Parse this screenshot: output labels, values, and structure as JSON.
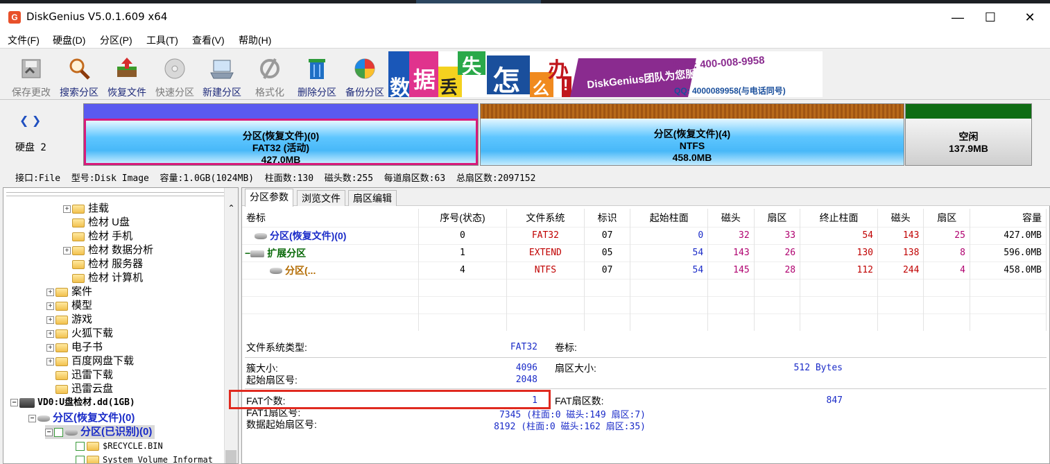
{
  "window": {
    "title": "DiskGenius V5.0.1.609 x64",
    "minimize": "—",
    "maximize": "☐",
    "close": "✕"
  },
  "menu": [
    "文件(F)",
    "硬盘(D)",
    "分区(P)",
    "工具(T)",
    "查看(V)",
    "帮助(H)"
  ],
  "toolbar": [
    {
      "label": "保存更改",
      "icon": "save-icon",
      "disabled": true
    },
    {
      "label": "搜索分区",
      "icon": "search-icon",
      "disabled": false
    },
    {
      "label": "恢复文件",
      "icon": "recover-icon",
      "disabled": false
    },
    {
      "label": "快速分区",
      "icon": "disc-icon",
      "disabled": true
    },
    {
      "label": "新建分区",
      "icon": "new-partition-icon",
      "disabled": false
    },
    {
      "label": "格式化",
      "icon": "format-icon",
      "disabled": true
    },
    {
      "label": "删除分区",
      "icon": "trash-icon",
      "disabled": false
    },
    {
      "label": "备份分区",
      "icon": "backup-icon",
      "disabled": false
    }
  ],
  "banner": {
    "chars": [
      "数",
      "据",
      "丢",
      "失",
      "怎",
      "么",
      "办",
      "!"
    ],
    "brand": "DiskGenius团队为您服务!",
    "phone": "致电: 400-008-9958",
    "qq": "QQ: 4000089958(与电话同号)"
  },
  "disk": {
    "label": "硬盘 2",
    "info": "接口:File  型号:Disk Image  容量:1.0GB(1024MB)  柱面数:130  磁头数:255  每道扇区数:63  总扇区数:2097152",
    "partitions": [
      {
        "name": "分区(恢复文件)(0)",
        "fs": "FAT32 (活动)",
        "size": "427.0MB"
      },
      {
        "name": "分区(恢复文件)(4)",
        "fs": "NTFS",
        "size": "458.0MB"
      },
      {
        "name": "空闲",
        "fs": "",
        "size": "137.9MB"
      }
    ]
  },
  "tree": [
    {
      "label": "挂载",
      "indent": 1,
      "plus": true
    },
    {
      "label": "检材 U盘",
      "indent": 1,
      "plus": false
    },
    {
      "label": "检材 手机",
      "indent": 1,
      "plus": false
    },
    {
      "label": "检材 数据分析",
      "indent": 1,
      "plus": true
    },
    {
      "label": "检材 服务器",
      "indent": 1,
      "plus": false
    },
    {
      "label": "检材 计算机",
      "indent": 1,
      "plus": false
    },
    {
      "label": "案件",
      "indent": 0,
      "plus": true
    },
    {
      "label": "模型",
      "indent": 0,
      "plus": true
    },
    {
      "label": "游戏",
      "indent": 0,
      "plus": true
    },
    {
      "label": "火狐下载",
      "indent": 0,
      "plus": true
    },
    {
      "label": "电子书",
      "indent": 0,
      "plus": true
    },
    {
      "label": "百度网盘下载",
      "indent": 0,
      "plus": true
    },
    {
      "label": "迅雷下载",
      "indent": 0,
      "plus": false
    },
    {
      "label": "迅雷云盘",
      "indent": 0,
      "plus": false
    }
  ],
  "tree_disk": {
    "label": "VD0:U盘检材.dd(1GB)",
    "part0": "分区(恢复文件)(0)",
    "part_sel": "分区(已识别)(0)",
    "recycle": "$RECYCLE.BIN",
    "sysvol": "System Volume Informat"
  },
  "tabs": [
    "分区参数",
    "浏览文件",
    "扇区编辑"
  ],
  "table": {
    "headers": [
      "卷标",
      "序号(状态)",
      "文件系统",
      "标识",
      "起始柱面",
      "磁头",
      "扇区",
      "终止柱面",
      "磁头",
      "扇区",
      "容量"
    ],
    "rows": [
      {
        "label": "分区(恢复文件)(0)",
        "cells": [
          "0",
          "FAT32",
          "07",
          "0",
          "32",
          "33",
          "54",
          "143",
          "25",
          "427.0MB"
        ]
      },
      {
        "label": "扩展分区",
        "cells": [
          "1",
          "EXTEND",
          "05",
          "54",
          "143",
          "26",
          "130",
          "138",
          "8",
          "596.0MB"
        ]
      },
      {
        "label": "分区(...",
        "cells": [
          "4",
          "NTFS",
          "07",
          "54",
          "145",
          "28",
          "112",
          "244",
          "4",
          "458.0MB"
        ]
      }
    ]
  },
  "info": {
    "fs_type_label": "文件系统类型:",
    "fs_type": "FAT32",
    "vol_label": "卷标:",
    "cluster_label": "簇大小:",
    "cluster": "4096",
    "sector_size_label": "扇区大小:",
    "sector_size": "512 Bytes",
    "start_sector_label": "起始扇区号:",
    "start_sector": "2048",
    "fat_count_label": "FAT个数:",
    "fat_count": "1",
    "fat_sectors_label": "FAT扇区数:",
    "fat_sectors": "847",
    "fat1_label": "FAT1扇区号:",
    "fat1": "7345 (柱面:0 磁头:149 扇区:7)",
    "data_start_label": "数据起始扇区号:",
    "data_start": "8192 (柱面:0 磁头:162 扇区:35)"
  }
}
